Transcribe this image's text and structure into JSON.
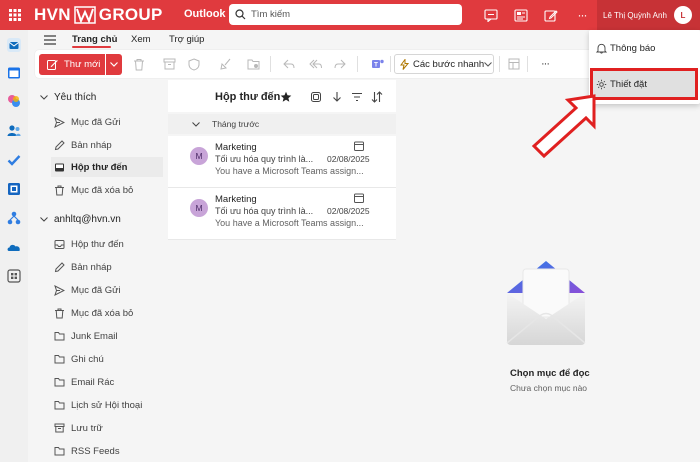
{
  "header": {
    "brand_left": "HVN",
    "brand_right": "GROUP",
    "app_name": "Outlook",
    "search_placeholder": "Tìm kiếm",
    "user_name": "Lê Thị Quỳnh Anh",
    "user_initial": "L",
    "more_label": "···",
    "accent_color": "#e03a3e"
  },
  "ribbon": {
    "tabs": [
      {
        "label": "Trang chủ",
        "active": true
      },
      {
        "label": "Xem",
        "active": false
      },
      {
        "label": "Trợ giúp",
        "active": false
      }
    ],
    "new_mail": "Thư mới",
    "quick_steps": "Các bước nhanh",
    "more_label": "···"
  },
  "favorites": {
    "title": "Yêu thích",
    "items": [
      {
        "label": "Mục đã Gửi",
        "icon": "send-icon"
      },
      {
        "label": "Bản nháp",
        "icon": "pencil-icon"
      },
      {
        "label": "Hộp thư đến",
        "icon": "inbox-icon",
        "selected": true
      },
      {
        "label": "Mục đã xóa bỏ",
        "icon": "trash-icon"
      }
    ]
  },
  "account": {
    "title": "anhltq@hvn.vn",
    "items": [
      {
        "label": "Hộp thư đến",
        "icon": "inbox-icon"
      },
      {
        "label": "Bản nháp",
        "icon": "pencil-icon"
      },
      {
        "label": "Mục đã Gửi",
        "icon": "send-icon"
      },
      {
        "label": "Mục đã xóa bỏ",
        "icon": "trash-icon"
      },
      {
        "label": "Junk Email",
        "icon": "folder-icon"
      },
      {
        "label": "Ghi chú",
        "icon": "folder-icon"
      },
      {
        "label": "Email Rác",
        "icon": "folder-icon"
      },
      {
        "label": "Lịch sử Hội thoại",
        "icon": "folder-icon"
      },
      {
        "label": "Lưu trữ",
        "icon": "archive-icon"
      },
      {
        "label": "RSS Feeds",
        "icon": "folder-icon"
      }
    ]
  },
  "message_list": {
    "title": "Hộp thư đến",
    "group_label": "Tháng trước",
    "messages": [
      {
        "initial": "M",
        "sender": "Marketing",
        "subject": "Tối ưu hóa quy trình là...",
        "date": "02/08/2025",
        "preview": "You have a Microsoft Teams assign..."
      },
      {
        "initial": "M",
        "sender": "Marketing",
        "subject": "Tối ưu hóa quy trình là...",
        "date": "02/08/2025",
        "preview": "You have a Microsoft Teams assign..."
      }
    ]
  },
  "reading_pane": {
    "title": "Chọn mục để đọc",
    "subtitle": "Chưa chọn mục nào"
  },
  "more_menu": {
    "items": [
      {
        "label": "Thông báo",
        "icon": "bell-icon"
      },
      {
        "label": "Thiết đặt",
        "icon": "gear-icon",
        "highlighted": true
      }
    ],
    "highlight_color": "#e02020"
  }
}
